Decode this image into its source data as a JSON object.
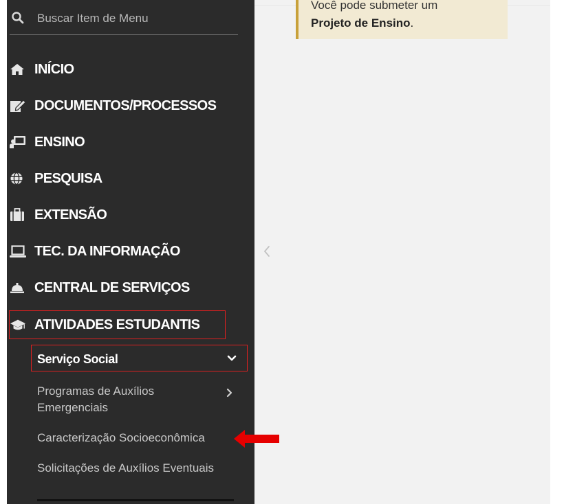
{
  "search": {
    "placeholder": "Buscar Item de Menu",
    "icon": "search-icon"
  },
  "menu": [
    {
      "key": "inicio",
      "label": "INÍCIO",
      "icon": "home-icon"
    },
    {
      "key": "documentos",
      "label": "DOCUMENTOS/PROCESSOS",
      "icon": "edit-document-icon"
    },
    {
      "key": "ensino",
      "label": "ENSINO",
      "icon": "teacher-board-icon"
    },
    {
      "key": "pesquisa",
      "label": "PESQUISA",
      "icon": "globe-icon"
    },
    {
      "key": "extensao",
      "label": "EXTENSÃO",
      "icon": "suitcase-icon"
    },
    {
      "key": "ti",
      "label": "TEC. DA INFORMAÇÃO",
      "icon": "laptop-icon"
    },
    {
      "key": "central",
      "label": "CENTRAL DE SERVIÇOS",
      "icon": "service-bell-icon"
    },
    {
      "key": "atividades",
      "label": "ATIVIDADES ESTUDANTIS",
      "icon": "graduation-cap-icon"
    }
  ],
  "submenu": {
    "label": "Serviço Social",
    "items": [
      {
        "line1": "Programas de Auxílios",
        "line2": "Emergenciais"
      },
      {
        "line1": "Caracterização Socioeconômica"
      },
      {
        "line1": "Solicitações de Auxílios Eventuais"
      }
    ]
  },
  "notice": {
    "line1": "Você pode submeter um",
    "bold": "Projeto de Ensino",
    "suffix": "."
  },
  "colors": {
    "sidebar_bg": "#2b2b2b",
    "highlight": "#e02020",
    "notice_bg": "#f2ead3",
    "notice_border": "#c8a13a"
  }
}
